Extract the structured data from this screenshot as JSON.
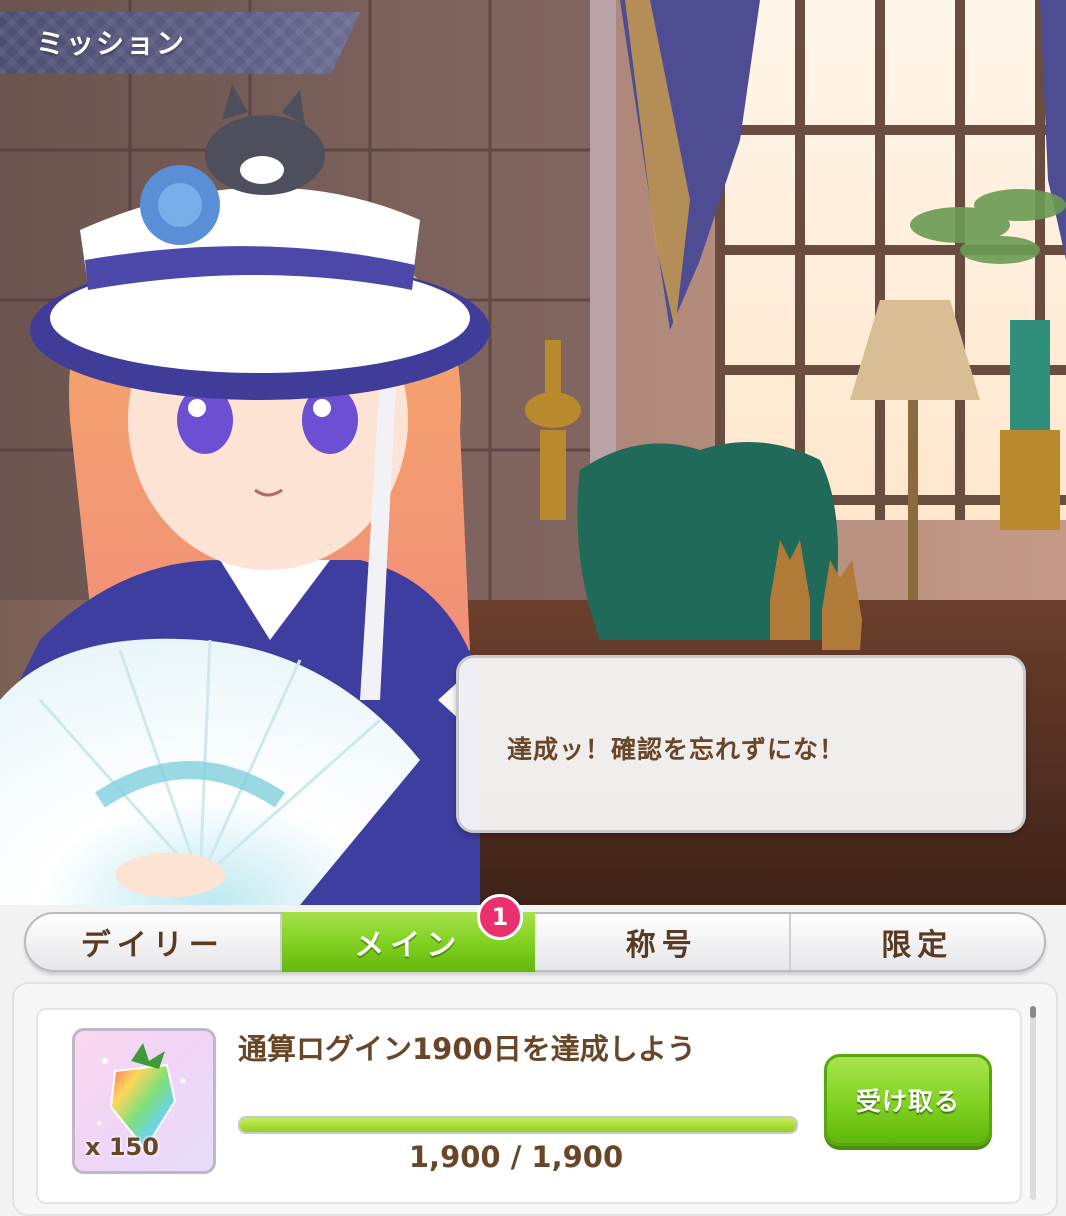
{
  "header": {
    "title": "ミッション"
  },
  "dialogue": {
    "text": "達成ッ！確認を忘れずにな！"
  },
  "tabs": [
    {
      "label": "デイリー",
      "active": false
    },
    {
      "label": "メイン",
      "active": true,
      "badge": "1"
    },
    {
      "label": "称号",
      "active": false
    },
    {
      "label": "限定",
      "active": false
    }
  ],
  "mission": {
    "title": "通算ログイン1900日を達成しよう",
    "reward_quantity": "x 150",
    "reward_icon": "rainbow-carrot-icon",
    "progress_text": "1,900 / 1,900",
    "progress_fraction": 1.0,
    "claim_label": "受け取る"
  },
  "colors": {
    "header": "#5d5f86",
    "active_tab": "#7fcf1f",
    "badge": "#ec2f6e",
    "text_brown": "#6a4628",
    "claim_button": "#80d121"
  }
}
